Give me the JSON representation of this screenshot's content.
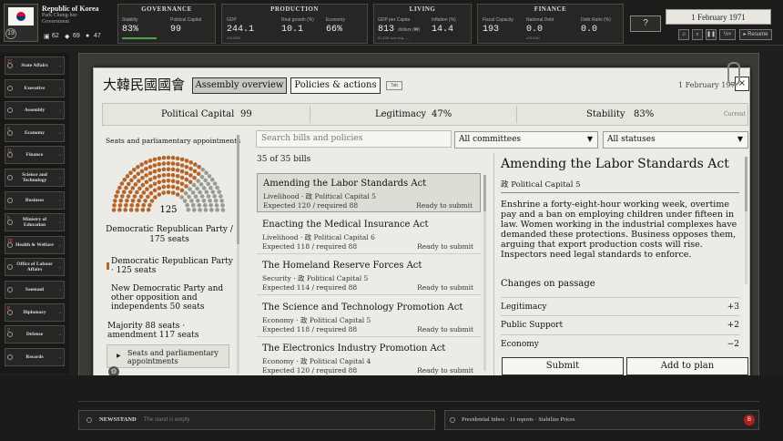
{
  "country": {
    "name": "Republic of Korea",
    "leader": "Park Chung-hee",
    "govt": "Government",
    "rank": "19",
    "stats": [
      "62",
      "69",
      "47"
    ]
  },
  "metrics": {
    "governance": {
      "title": "GOVERNANCE",
      "stability_label": "Stability",
      "stability": "83%",
      "capital_label": "Political Capital",
      "capital": "99"
    },
    "production": {
      "title": "PRODUCTION",
      "gdp_label": "GDP",
      "gdp": "244.1",
      "gdp_sub": "cS100M",
      "growth_label": "Real growth (%)",
      "growth": "10.1",
      "economy_label": "Economy",
      "economy": "66%"
    },
    "living": {
      "title": "LIVING",
      "gdppc_label": "GDP per Capita",
      "gdppc": "813",
      "gdppc_unit": "dollars (₩)",
      "gdppc_sub": "81,838 won avg. —",
      "inflation_label": "Inflation (%)",
      "inflation": "14.4"
    },
    "finance": {
      "title": "FINANCE",
      "fiscal_label": "Fiscal Capacity",
      "fiscal": "193",
      "debt_label": "National Debt",
      "debt": "0.0",
      "debt_sub": "cS100M",
      "ratio_label": "Debt Ratio (%)",
      "ratio": "0.0"
    }
  },
  "topright": {
    "help": "?",
    "date": "1 February 1971",
    "resume": "▸ Resume",
    "speed": "½×"
  },
  "sidebar": [
    {
      "label": "State Affairs",
      "badge": "27"
    },
    {
      "label": "Executive",
      "badge": ""
    },
    {
      "label": "Assembly",
      "badge": ""
    },
    {
      "label": "Economy",
      "badge": "4"
    },
    {
      "label": "Finance",
      "badge": "11"
    },
    {
      "label": "Science and Technology",
      "badge": ""
    },
    {
      "label": "Business",
      "badge": ""
    },
    {
      "label": "Ministry of Education",
      "badge": "5"
    },
    {
      "label": "Health & Welfare",
      "badge": "26"
    },
    {
      "label": "Office of Labour Affairs",
      "badge": ""
    },
    {
      "label": "Saemaul",
      "badge": ""
    },
    {
      "label": "Diplomacy",
      "badge": "8"
    },
    {
      "label": "Defense",
      "badge": "2"
    },
    {
      "label": "Records",
      "badge": ""
    }
  ],
  "dialog": {
    "title": "大韓民國國會",
    "tab_overview": "Assembly overview",
    "tab_policies": "Policies & actions",
    "tab_key": "Tab",
    "date": "1 February 1971",
    "close": "×",
    "stat_capital": "Political Capital",
    "stat_capital_val": "99",
    "stat_legit": "Legitimacy",
    "stat_legit_val": "47%",
    "stat_stab": "Stability",
    "stat_stab_val": "83%",
    "stat_current": "Current"
  },
  "assembly": {
    "header": "Seats and parliamentary appointments",
    "total": "125",
    "party1": "Democratic Republican Party / 175 seats",
    "party2": "Democratic Republican Party · 125 seats",
    "party3": "New Democratic Party and other opposition and independents 50 seats",
    "majority": "Majority 88 seats · amendment 117 seats",
    "seat_button": "Seats and parliamentary appointments",
    "seats_total": 175,
    "seats_ruling": 125
  },
  "bills": {
    "search_placeholder": "Search bills and policies",
    "committee": "All committees",
    "status": "All statuses",
    "count": "35 of 35 bills",
    "items": [
      {
        "title": "Amending the Labor Standards Act",
        "sub": "Livelihood · 政 Political Capital 5",
        "exp": "Expected 120 / required 88",
        "status": "Ready to submit"
      },
      {
        "title": "Enacting the Medical Insurance Act",
        "sub": "Livelihood · 政 Political Capital 6",
        "exp": "Expected 118 / required 88",
        "status": "Ready to submit"
      },
      {
        "title": "The Homeland Reserve Forces Act",
        "sub": "Security · 政 Political Capital 5",
        "exp": "Expected 114 / required 88",
        "status": "Ready to submit"
      },
      {
        "title": "The Science and Technology Promotion Act",
        "sub": "Economy · 政 Political Capital 5",
        "exp": "Expected 118 / required 88",
        "status": "Ready to submit"
      },
      {
        "title": "The Electronics Industry Promotion Act",
        "sub": "Economy · 政 Political Capital 4",
        "exp": "Expected 120 / required 88",
        "status": "Ready to submit"
      }
    ]
  },
  "detail": {
    "title": "Amending the Labor Standards Act",
    "cost": "政 Political Capital 5",
    "desc": "Enshrine a forty-eight-hour working week, overtime pay and a ban on employing children under fifteen in law. Women working in the industrial complexes have demanded these protections. Business opposes them, arguing that export production costs will rise. Inspectors need legal standards to enforce.",
    "changes_title": "Changes on passage",
    "changes": [
      {
        "label": "Legitimacy",
        "value": "+3"
      },
      {
        "label": "Public Support",
        "value": "+2"
      },
      {
        "label": "Economy",
        "value": "−2"
      }
    ],
    "submit": "Submit",
    "add": "Add to plan"
  },
  "bottom": {
    "newsstand": "NEWSSTAND",
    "news_empty": "The stand is empty",
    "inbox": "Presidential Inbox · 11 reports · Stabilize Prices",
    "inbox_badge": "B"
  }
}
